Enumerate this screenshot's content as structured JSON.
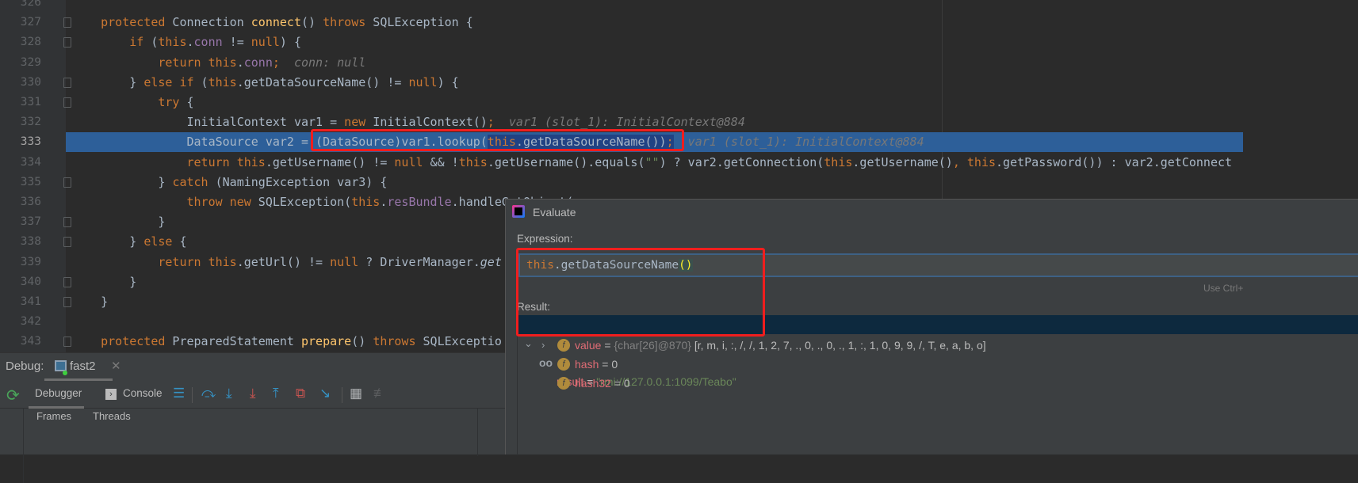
{
  "editor": {
    "current_line": 333,
    "lines": [
      {
        "n": "326",
        "fold": false,
        "tokens": []
      },
      {
        "n": "327",
        "fold": true,
        "tokens": [
          {
            "t": "    "
          },
          {
            "t": "protected",
            "c": "kw"
          },
          {
            "t": " Connection "
          },
          {
            "t": "connect",
            "c": "m"
          },
          {
            "t": "() "
          },
          {
            "t": "throws",
            "c": "kw"
          },
          {
            "t": " SQLException {"
          }
        ]
      },
      {
        "n": "328",
        "fold": true,
        "tokens": [
          {
            "t": "        "
          },
          {
            "t": "if",
            "c": "kw"
          },
          {
            "t": " ("
          },
          {
            "t": "this",
            "c": "kw"
          },
          {
            "t": "."
          },
          {
            "t": "conn",
            "c": "f"
          },
          {
            "t": " != "
          },
          {
            "t": "null",
            "c": "kw"
          },
          {
            "t": ") {"
          }
        ]
      },
      {
        "n": "329",
        "fold": false,
        "tokens": [
          {
            "t": "            "
          },
          {
            "t": "return ",
            "c": "kw"
          },
          {
            "t": "this",
            "c": "kw"
          },
          {
            "t": "."
          },
          {
            "t": "conn",
            "c": "f"
          },
          {
            "t": ";",
            "c": "kw"
          },
          {
            "t": "  conn: null",
            "c": "hint"
          }
        ]
      },
      {
        "n": "330",
        "fold": true,
        "tokens": [
          {
            "t": "        } "
          },
          {
            "t": "else if",
            "c": "kw"
          },
          {
            "t": " ("
          },
          {
            "t": "this",
            "c": "kw"
          },
          {
            "t": ".getDataSourceName() != "
          },
          {
            "t": "null",
            "c": "kw"
          },
          {
            "t": ") {"
          }
        ]
      },
      {
        "n": "331",
        "fold": true,
        "tokens": [
          {
            "t": "            "
          },
          {
            "t": "try",
            "c": "kw"
          },
          {
            "t": " {"
          }
        ]
      },
      {
        "n": "332",
        "fold": false,
        "tokens": [
          {
            "t": "                InitialContext var1 = "
          },
          {
            "t": "new",
            "c": "kw"
          },
          {
            "t": " InitialContext()"
          },
          {
            "t": ";",
            "c": "kw"
          },
          {
            "t": "  var1 (slot_1): InitialContext@884",
            "c": "hint"
          }
        ]
      },
      {
        "n": "333",
        "fold": false,
        "tokens": [
          {
            "t": "                DataSource var2 = (DataSource)var1.lookup("
          },
          {
            "t": "this",
            "c": "kw sel"
          },
          {
            "t": ".getDataSourceName())",
            "c": "sel"
          },
          {
            "t": ";",
            "c": "kw sel"
          },
          {
            "t": "  var1 (slot_1): InitialContext@884",
            "c": "hint"
          }
        ]
      },
      {
        "n": "334",
        "fold": false,
        "tokens": [
          {
            "t": "                "
          },
          {
            "t": "return ",
            "c": "kw"
          },
          {
            "t": "this",
            "c": "kw"
          },
          {
            "t": ".getUsername() != "
          },
          {
            "t": "null",
            "c": "kw"
          },
          {
            "t": " && !"
          },
          {
            "t": "this",
            "c": "kw"
          },
          {
            "t": ".getUsername().equals("
          },
          {
            "t": "\"\"",
            "c": "s"
          },
          {
            "t": ") ? var2.getConnection("
          },
          {
            "t": "this",
            "c": "kw"
          },
          {
            "t": ".getUsername()"
          },
          {
            "t": ",",
            "c": "kw"
          },
          {
            "t": " "
          },
          {
            "t": "this",
            "c": "kw"
          },
          {
            "t": ".getPassword()) : var2.getConnect"
          }
        ]
      },
      {
        "n": "335",
        "fold": true,
        "tokens": [
          {
            "t": "            } "
          },
          {
            "t": "catch",
            "c": "kw"
          },
          {
            "t": " (NamingException var3) {"
          }
        ]
      },
      {
        "n": "336",
        "fold": false,
        "tokens": [
          {
            "t": "                "
          },
          {
            "t": "throw new",
            "c": "kw"
          },
          {
            "t": " SQLException("
          },
          {
            "t": "this",
            "c": "kw"
          },
          {
            "t": "."
          },
          {
            "t": "resBundle",
            "c": "f"
          },
          {
            "t": ".handleGetObject("
          }
        ]
      },
      {
        "n": "337",
        "fold": true,
        "tokens": [
          {
            "t": "            }"
          }
        ]
      },
      {
        "n": "338",
        "fold": true,
        "tokens": [
          {
            "t": "        } "
          },
          {
            "t": "else",
            "c": "kw"
          },
          {
            "t": " {"
          }
        ]
      },
      {
        "n": "339",
        "fold": false,
        "tokens": [
          {
            "t": "            "
          },
          {
            "t": "return ",
            "c": "kw"
          },
          {
            "t": "this",
            "c": "kw"
          },
          {
            "t": ".getUrl() != "
          },
          {
            "t": "null",
            "c": "kw"
          },
          {
            "t": " ? DriverManager."
          },
          {
            "t": "get",
            "c": "it"
          }
        ]
      },
      {
        "n": "340",
        "fold": true,
        "tokens": [
          {
            "t": "        }"
          }
        ]
      },
      {
        "n": "341",
        "fold": true,
        "tokens": [
          {
            "t": "    }"
          }
        ]
      },
      {
        "n": "342",
        "fold": false,
        "tokens": []
      },
      {
        "n": "343",
        "fold": true,
        "tokens": [
          {
            "t": "    "
          },
          {
            "t": "protected",
            "c": "kw"
          },
          {
            "t": " PreparedStatement "
          },
          {
            "t": "prepare",
            "c": "m"
          },
          {
            "t": "() "
          },
          {
            "t": "throws",
            "c": "kw"
          },
          {
            "t": " SQLExceptio"
          }
        ]
      }
    ]
  },
  "debug": {
    "title": "Debug:",
    "session_tab": "fast2",
    "tabs": [
      "Debugger",
      "Console"
    ],
    "bottom_tabs": [
      "Frames",
      "Threads"
    ]
  },
  "evaluate": {
    "title": "Evaluate",
    "expression_label": "Expression:",
    "expression_this": "this",
    "expression_method": ".getDataSourceName",
    "expression_parens": "()",
    "hint": "Use Ctrl+",
    "result_label": "Result:",
    "result": {
      "name": "result",
      "eq": " = ",
      "value": "\"rmi://127.0.0.1:1099/Teabo\""
    },
    "fields": [
      {
        "name": "value",
        "type": "{char[26]@870}",
        "value": "[r, m, i, :, /, /, 1, 2, 7, ., 0, ., 0, ., 1, :, 1, 0, 9, 9, /, T, e, a, b, o]",
        "expandable": true
      },
      {
        "name": "hash",
        "type": "",
        "value": "0",
        "expandable": false
      },
      {
        "name": "hash32",
        "type": "",
        "value": "0",
        "expandable": false
      }
    ]
  },
  "colors": {
    "highlight": "#f01e1e",
    "current_line": "#2d5f99",
    "keyword": "#cc7832"
  }
}
